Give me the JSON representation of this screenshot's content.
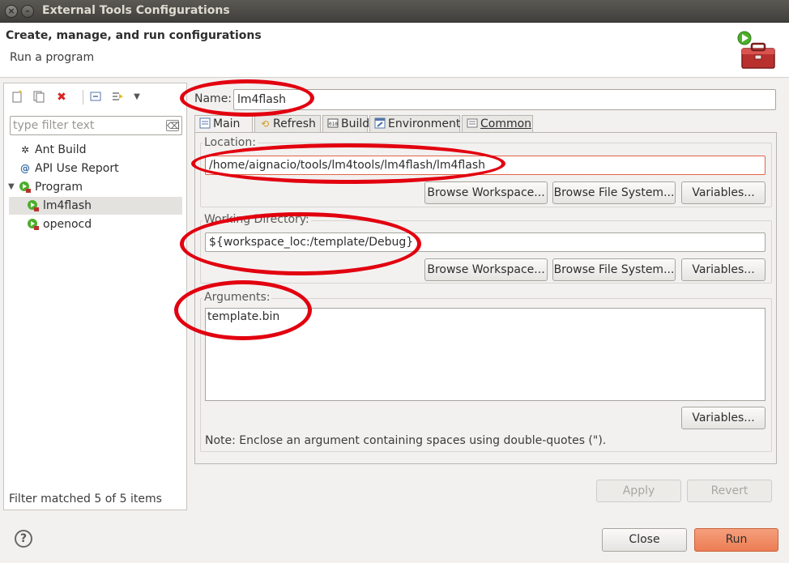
{
  "window": {
    "title": "External Tools Configurations"
  },
  "header": {
    "title": "Create, manage, and run configurations",
    "subtitle": "Run a program"
  },
  "left": {
    "filter_placeholder": "type filter text",
    "tree": [
      {
        "label": "Ant Build",
        "icon": "ant-icon"
      },
      {
        "label": "API Use Report",
        "icon": "api-report-icon"
      },
      {
        "label": "Program",
        "icon": "program-icon"
      },
      {
        "label": "lm4flash",
        "icon": "program-config-icon"
      },
      {
        "label": "openocd",
        "icon": "program-config-icon"
      }
    ],
    "status": "Filter matched 5 of 5 items"
  },
  "name": {
    "label": "Name:",
    "value": "lm4flash"
  },
  "tabs": [
    {
      "label": "Main",
      "icon": "main-tab-icon"
    },
    {
      "label": "Refresh",
      "icon": "refresh-icon"
    },
    {
      "label": "Build",
      "icon": "build-icon"
    },
    {
      "label": "Environment",
      "icon": "environment-icon"
    },
    {
      "label": "Common",
      "icon": "common-icon"
    }
  ],
  "location": {
    "label": "Location:",
    "value": "/home/aignacio/tools/lm4tools/lm4flash/lm4flash",
    "browse_workspace": "Browse Workspace...",
    "browse_fs": "Browse File System...",
    "variables": "Variables..."
  },
  "workdir": {
    "label": "Working Directory:",
    "value": "${workspace_loc:/template/Debug}",
    "browse_workspace": "Browse Workspace...",
    "browse_fs": "Browse File System...",
    "variables": "Variables..."
  },
  "arguments": {
    "label": "Arguments:",
    "value": "template.bin",
    "variables": "Variables...",
    "note": "Note: Enclose an argument containing spaces using double-quotes (\")."
  },
  "actions": {
    "apply": "Apply",
    "revert": "Revert",
    "close": "Close",
    "run": "Run"
  },
  "help": {
    "symbol": "?"
  },
  "colors": {
    "annotation": "#e2000f",
    "run_button": "#ec7d54",
    "error_border": "#e2634a"
  }
}
